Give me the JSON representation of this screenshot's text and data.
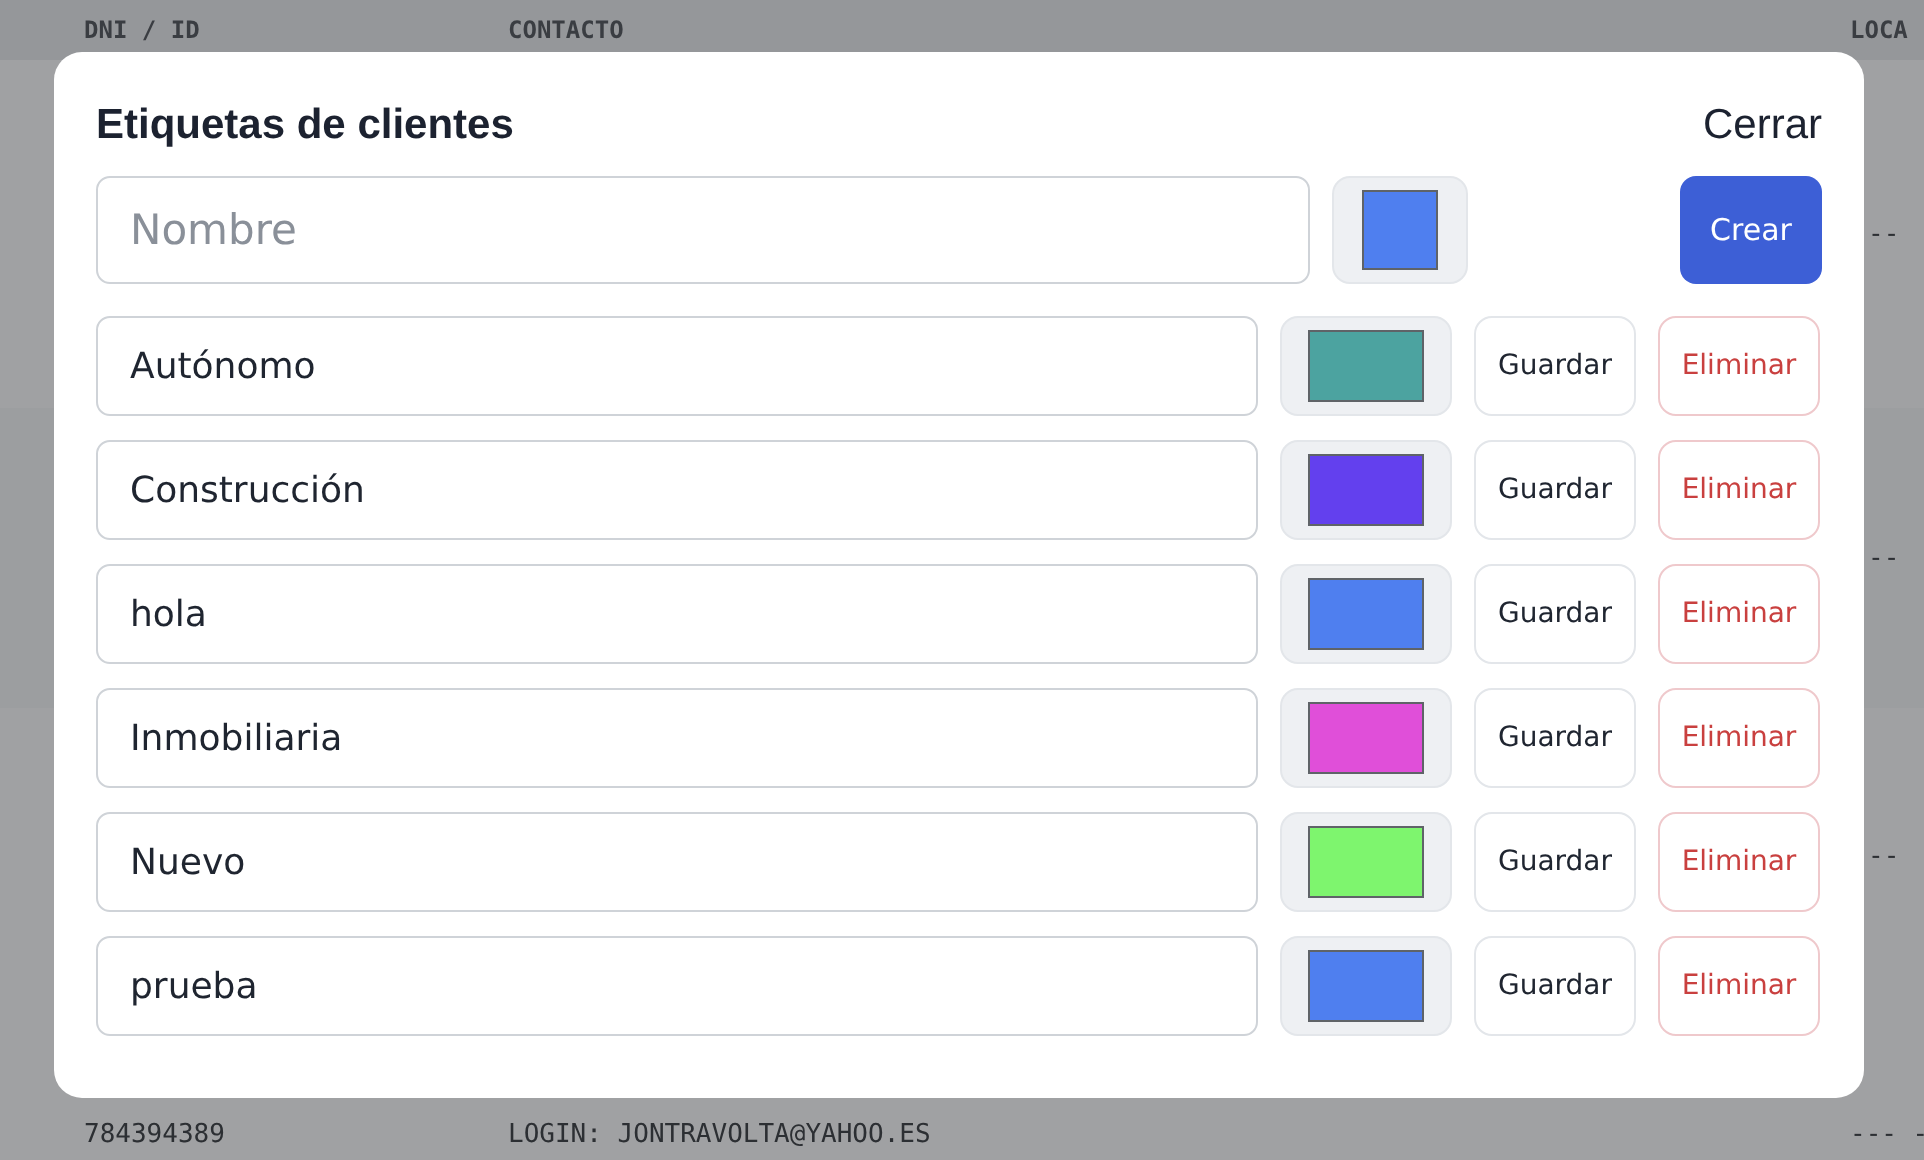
{
  "background_table": {
    "columns": [
      "DNI / ID",
      "CONTACTO",
      "LOCA"
    ],
    "rows": [
      {
        "column_3": "--"
      },
      {
        "column_3": "--"
      },
      {
        "column_3": "--"
      },
      {
        "dni": "784394389",
        "contacto": "LOGIN: JONTRAVOLTA@YAHOO.ES",
        "column_3": "--- -"
      }
    ]
  },
  "dialog": {
    "title": "Etiquetas de clientes",
    "close_label": "Cerrar",
    "new_tag": {
      "placeholder": "Nombre",
      "color": "#4f7fef",
      "create_label": "Crear"
    },
    "tags": [
      {
        "name": "Autónomo",
        "color": "#4ca3a0",
        "save_label": "Guardar",
        "delete_label": "Eliminar"
      },
      {
        "name": "Construcción",
        "color": "#6340ee",
        "save_label": "Guardar",
        "delete_label": "Eliminar"
      },
      {
        "name": "hola",
        "color": "#4f7fef",
        "save_label": "Guardar",
        "delete_label": "Eliminar"
      },
      {
        "name": "Inmobiliaria",
        "color": "#e04fd9",
        "save_label": "Guardar",
        "delete_label": "Eliminar"
      },
      {
        "name": "Nuevo",
        "color": "#7ef56e",
        "save_label": "Guardar",
        "delete_label": "Eliminar"
      },
      {
        "name": "prueba",
        "color": "#4f7fef",
        "save_label": "Guardar",
        "delete_label": "Eliminar"
      }
    ]
  }
}
